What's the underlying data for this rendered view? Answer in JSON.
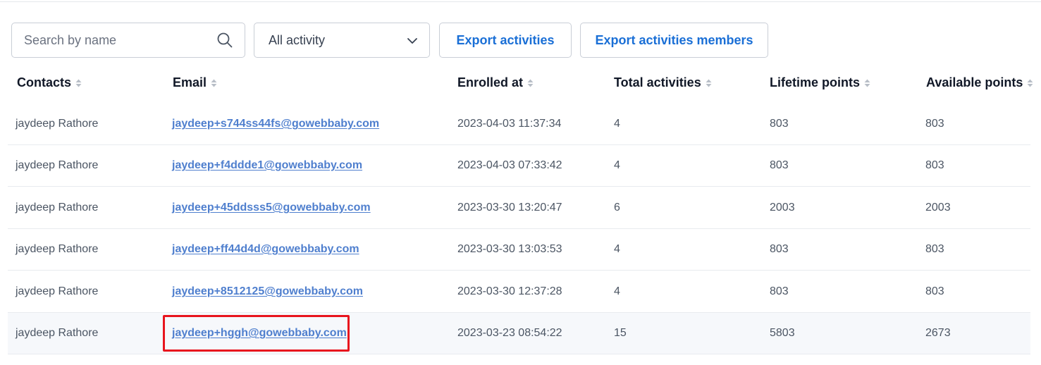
{
  "search": {
    "placeholder": "Search by name"
  },
  "filter": {
    "selected": "All activity"
  },
  "buttons": {
    "export_activities": "Export activities",
    "export_activities_members": "Export activities members"
  },
  "columns": [
    "Contacts",
    "Email",
    "Enrolled at",
    "Total activities",
    "Lifetime points",
    "Available points"
  ],
  "rows": [
    {
      "contact": "jaydeep Rathore",
      "email": "jaydeep+s744ss44fs@gowebbaby.com",
      "enrolled": "2023-04-03 11:37:34",
      "total": "4",
      "lifetime": "803",
      "available": "803"
    },
    {
      "contact": "jaydeep Rathore",
      "email": "jaydeep+f4ddde1@gowebbaby.com",
      "enrolled": "2023-04-03 07:33:42",
      "total": "4",
      "lifetime": "803",
      "available": "803"
    },
    {
      "contact": "jaydeep Rathore",
      "email": "jaydeep+45ddsss5@gowebbaby.com",
      "enrolled": "2023-03-30 13:20:47",
      "total": "6",
      "lifetime": "2003",
      "available": "2003"
    },
    {
      "contact": "jaydeep Rathore",
      "email": "jaydeep+ff44d4d@gowebbaby.com",
      "enrolled": "2023-03-30 13:03:53",
      "total": "4",
      "lifetime": "803",
      "available": "803"
    },
    {
      "contact": "jaydeep Rathore",
      "email": "jaydeep+8512125@gowebbaby.com",
      "enrolled": "2023-03-30 12:37:28",
      "total": "4",
      "lifetime": "803",
      "available": "803"
    },
    {
      "contact": "jaydeep Rathore",
      "email": "jaydeep+hggh@gowebbaby.com",
      "enrolled": "2023-03-23 08:54:22",
      "total": "15",
      "lifetime": "5803",
      "available": "2673"
    }
  ],
  "colors": {
    "accent": "#1a6fd6",
    "link": "#4f7fce",
    "highlight_border": "#e8141d",
    "highlighted_row_bg": "#f6f8fb"
  },
  "icons": {
    "search": "search-icon",
    "dropdown": "chevron-down-icon",
    "sort": "sort-icon"
  }
}
